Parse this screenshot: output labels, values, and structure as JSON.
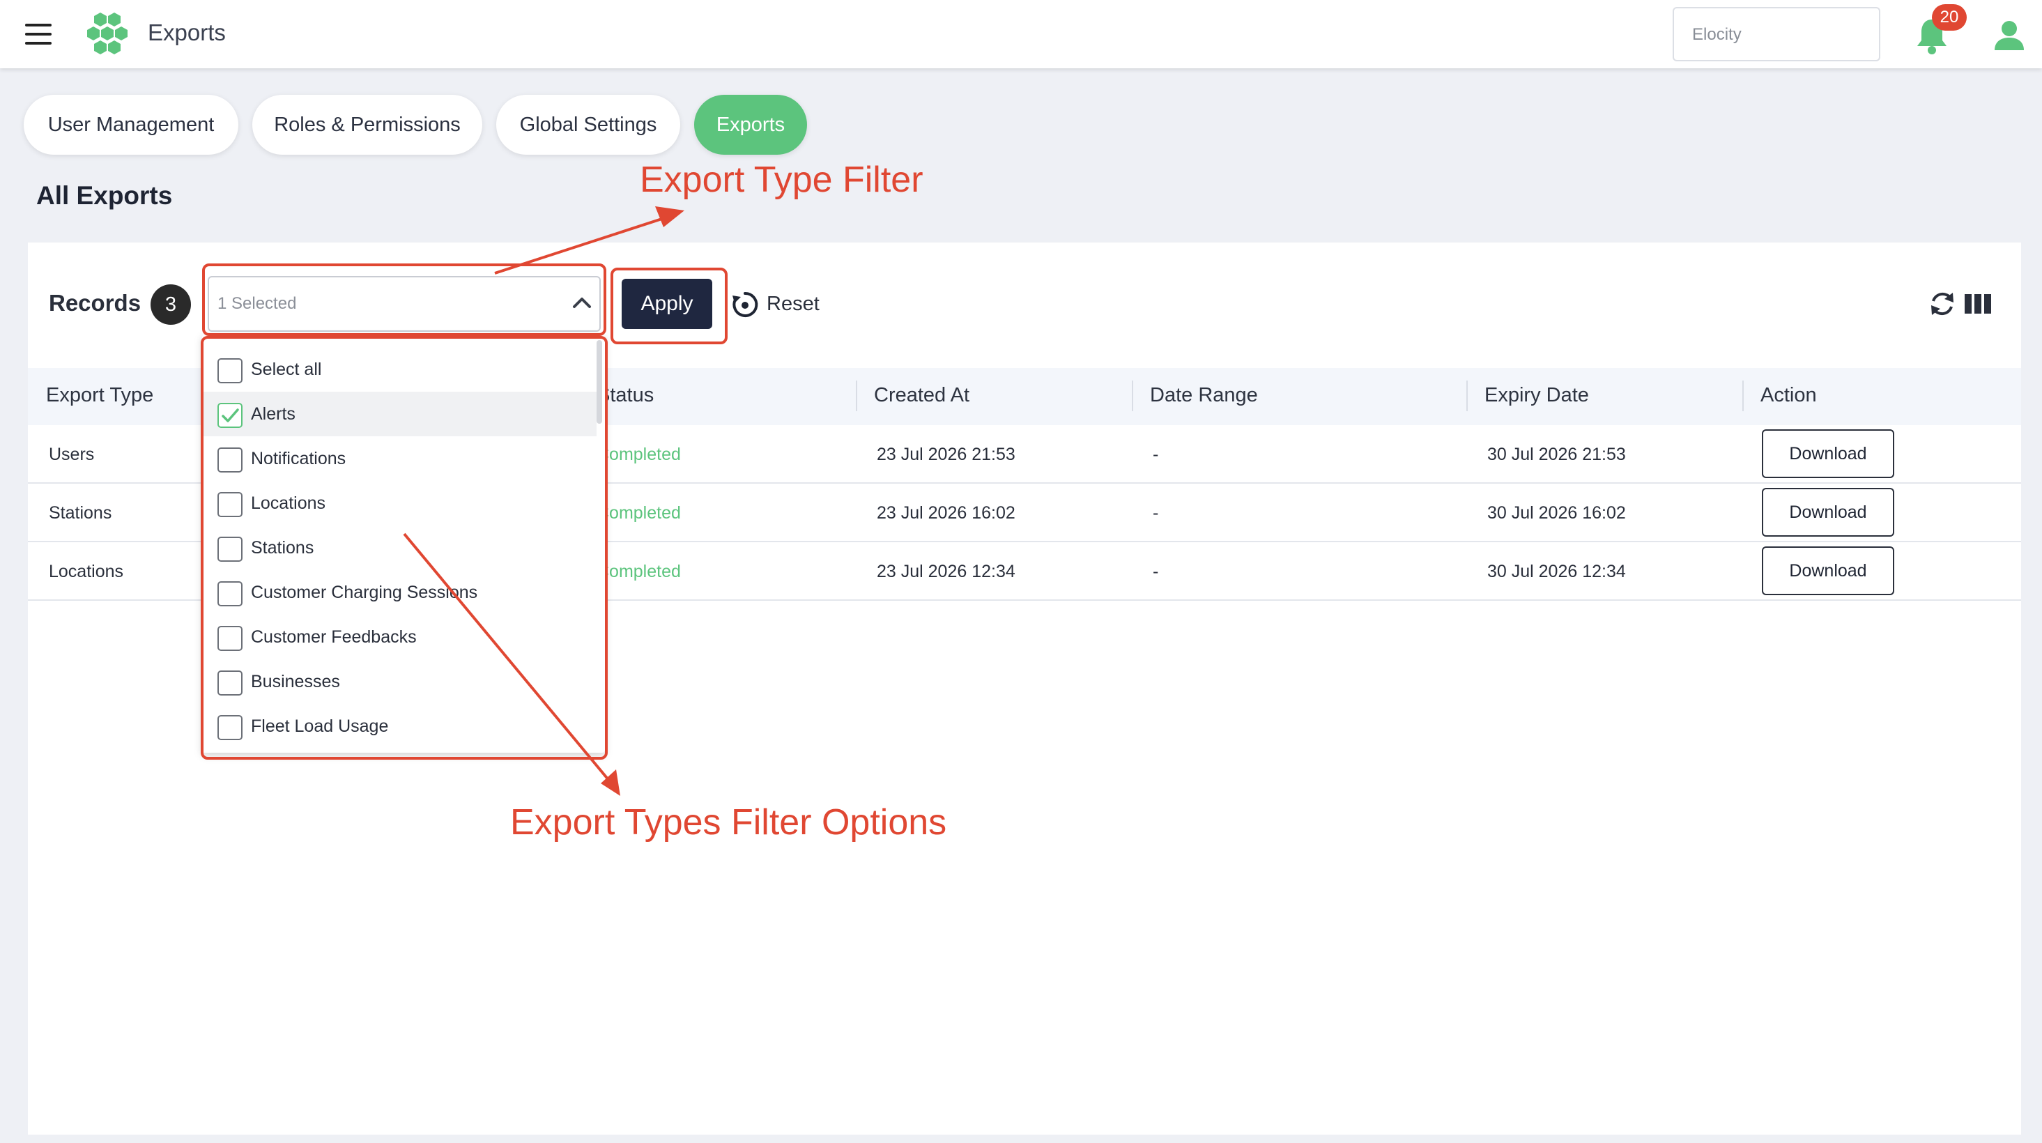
{
  "header": {
    "app_title": "Exports",
    "search_placeholder": "Elocity",
    "notification_count": "20"
  },
  "tabs": [
    {
      "label": "User Management",
      "active": false
    },
    {
      "label": "Roles & Permissions",
      "active": false
    },
    {
      "label": "Global Settings",
      "active": false
    },
    {
      "label": "Exports",
      "active": true
    }
  ],
  "page": {
    "title": "All Exports"
  },
  "toolbar": {
    "records_label": "Records",
    "records_count": "3",
    "filter_value": "1 Selected",
    "apply_label": "Apply",
    "reset_label": "Reset"
  },
  "table": {
    "columns": [
      "Export Type",
      "Status",
      "Created At",
      "Date Range",
      "Expiry Date",
      "Action"
    ],
    "rows": [
      {
        "export_type": "Users",
        "status": "Completed",
        "created_at": "23 Jul 2026 21:53",
        "date_range": "-",
        "expiry_date": "30 Jul 2026 21:53",
        "action": "Download"
      },
      {
        "export_type": "Stations",
        "status": "Completed",
        "created_at": "23 Jul 2026 16:02",
        "date_range": "-",
        "expiry_date": "30 Jul 2026 16:02",
        "action": "Download"
      },
      {
        "export_type": "Locations",
        "status": "Completed",
        "created_at": "23 Jul 2026 12:34",
        "date_range": "-",
        "expiry_date": "30 Jul 2026 12:34",
        "action": "Download"
      }
    ]
  },
  "dropdown": {
    "options": [
      {
        "label": "Select all",
        "checked": false
      },
      {
        "label": "Alerts",
        "checked": true
      },
      {
        "label": "Notifications",
        "checked": false
      },
      {
        "label": "Locations",
        "checked": false
      },
      {
        "label": "Stations",
        "checked": false
      },
      {
        "label": "Customer Charging Sessions",
        "checked": false
      },
      {
        "label": "Customer Feedbacks",
        "checked": false
      },
      {
        "label": "Businesses",
        "checked": false
      },
      {
        "label": "Fleet Load Usage",
        "checked": false
      }
    ]
  },
  "annotations": {
    "filter_label": "Export Type Filter",
    "options_label": "Export Types Filter Options"
  },
  "colors": {
    "accent_green": "#5cc47d",
    "annotation_red": "#e04732",
    "apply_bg": "#1f2740",
    "badge_red": "#e04732"
  },
  "icons": [
    "menu-icon",
    "logo-icon",
    "bell-icon",
    "user-icon",
    "chevron-up-icon",
    "reset-icon",
    "refresh-icon",
    "columns-icon",
    "check-icon"
  ]
}
